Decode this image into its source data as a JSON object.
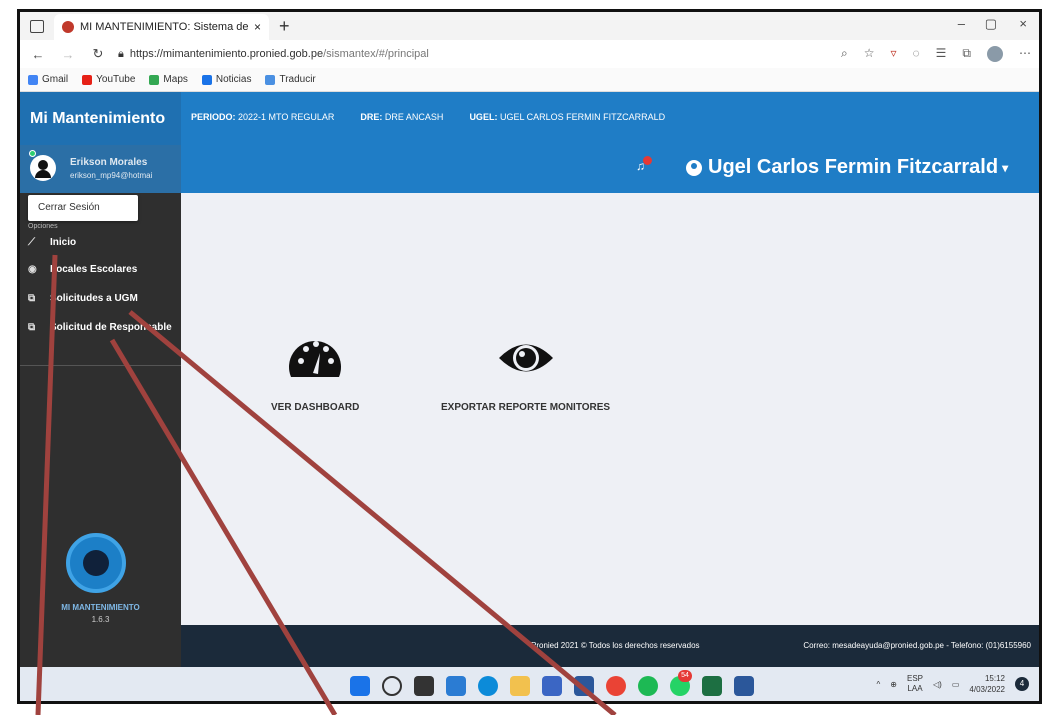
{
  "browser": {
    "tab_title": "MI MANTENIMIENTO: Sistema de",
    "tab_close": "×",
    "new_tab": "+",
    "window_min": "–",
    "window_max": "▢",
    "window_close": "×",
    "url_host": "https://mimantenimiento.pronied.gob.pe",
    "url_path": "/sismantex/#/principal",
    "bookmarks": [
      "Gmail",
      "YouTube",
      "Maps",
      "Noticias",
      "Traducir"
    ]
  },
  "app": {
    "brand": "Mi Mantenimiento",
    "period_label": "PERIODO:",
    "period_value": "2022-1 MTO REGULAR",
    "dre_label": "DRE:",
    "dre_value": "DRE ANCASH",
    "ugel_label": "UGEL:",
    "ugel_value": "UGEL CARLOS FERMIN FITZCARRALD",
    "header_title": "Ugel Carlos Fermin Fitzcarrald"
  },
  "user": {
    "name": "Erikson Morales",
    "email": "erikson_mp94@hotmai",
    "logout": "Cerrar Sesión",
    "section_label": "Opciones"
  },
  "sidebar": {
    "items": [
      {
        "label": "Inicio",
        "icon": "chart-line-icon",
        "glyph": "⟋"
      },
      {
        "label": "Locales Escolares",
        "icon": "school-icon",
        "glyph": "◉"
      },
      {
        "label": "Solicitudes a UGM",
        "icon": "copy-icon",
        "glyph": "⧉"
      },
      {
        "label": "Solicitud de Responsable",
        "icon": "copy-icon",
        "glyph": "⧉"
      }
    ],
    "app_name": "MI MANTENIMIENTO",
    "version": "1.6.3"
  },
  "main": {
    "cards": [
      {
        "label": "VER DASHBOARD",
        "icon": "dashboard-gauge-icon"
      },
      {
        "label": "EXPORTAR REPORTE MONITORES",
        "icon": "eye-icon"
      }
    ]
  },
  "footer": {
    "copyright": "Pronied 2021 © Todos los derechos reservados",
    "contact": "Correo: mesadeayuda@pronied.gob.pe - Telefono: (01)6155960"
  },
  "taskbar": {
    "lang_line1": "ESP",
    "lang_line2": "LAA",
    "time": "15:12",
    "date": "4/03/2022",
    "notifications": "4",
    "chat_badge": "54"
  },
  "colors": {
    "brand_blue": "#1f7dc6",
    "sidebar_dark": "#2f2f2f",
    "annotation_red": "#a0423e"
  }
}
